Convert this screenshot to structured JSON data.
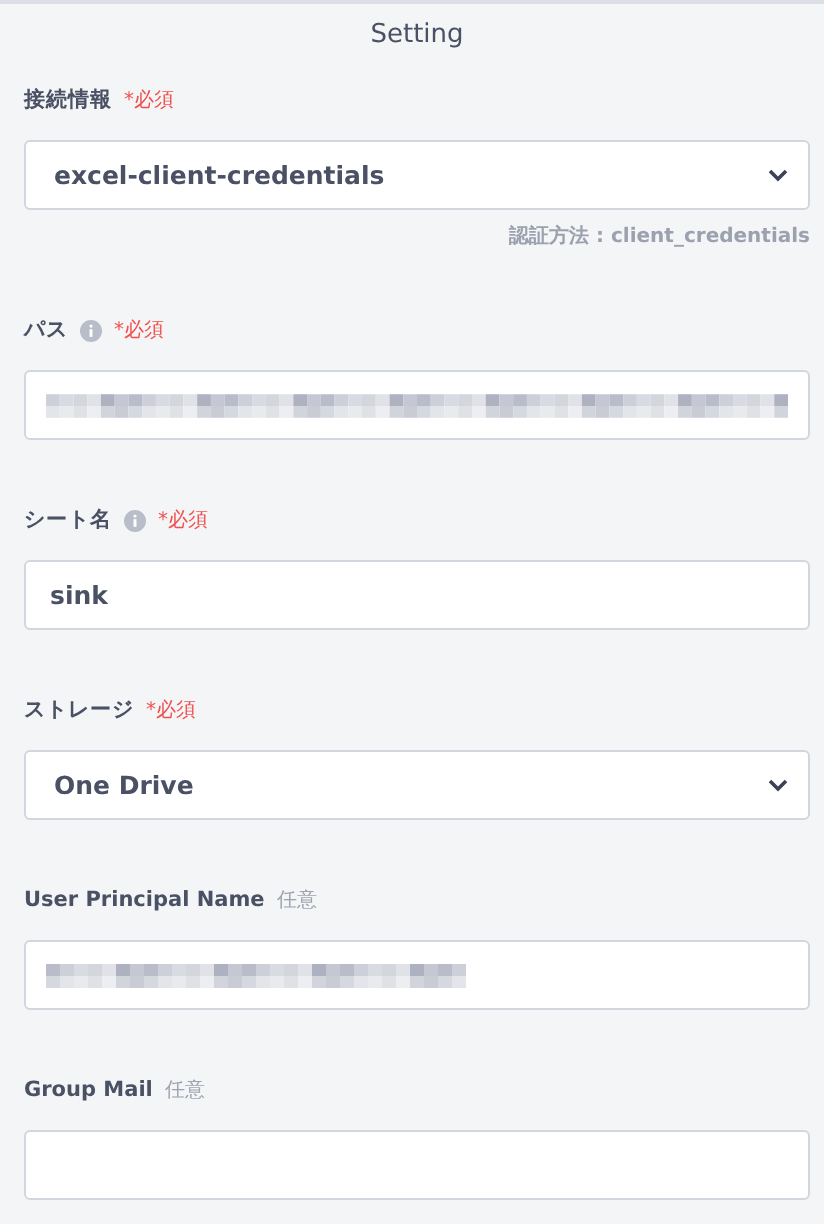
{
  "title": "Setting",
  "fields": [
    {
      "kind": "select",
      "label": "接続情報",
      "required": true,
      "tag": "*必須",
      "info": false,
      "value": "excel-client-credentials",
      "hint": "認証方法 : client_credentials"
    },
    {
      "kind": "redacted",
      "label": "パス",
      "required": true,
      "tag": "*必須",
      "info": true
    },
    {
      "kind": "input",
      "label": "シート名",
      "required": true,
      "tag": "*必須",
      "info": true,
      "value": "sink"
    },
    {
      "kind": "select",
      "label": "ストレージ",
      "required": true,
      "tag": "*必須",
      "info": false,
      "value": "One Drive"
    },
    {
      "kind": "redacted",
      "label": "User Principal Name",
      "required": false,
      "tag": "任意",
      "info": false,
      "short": true
    },
    {
      "kind": "input",
      "label": "Group Mail",
      "required": false,
      "tag": "任意",
      "info": false
    }
  ]
}
